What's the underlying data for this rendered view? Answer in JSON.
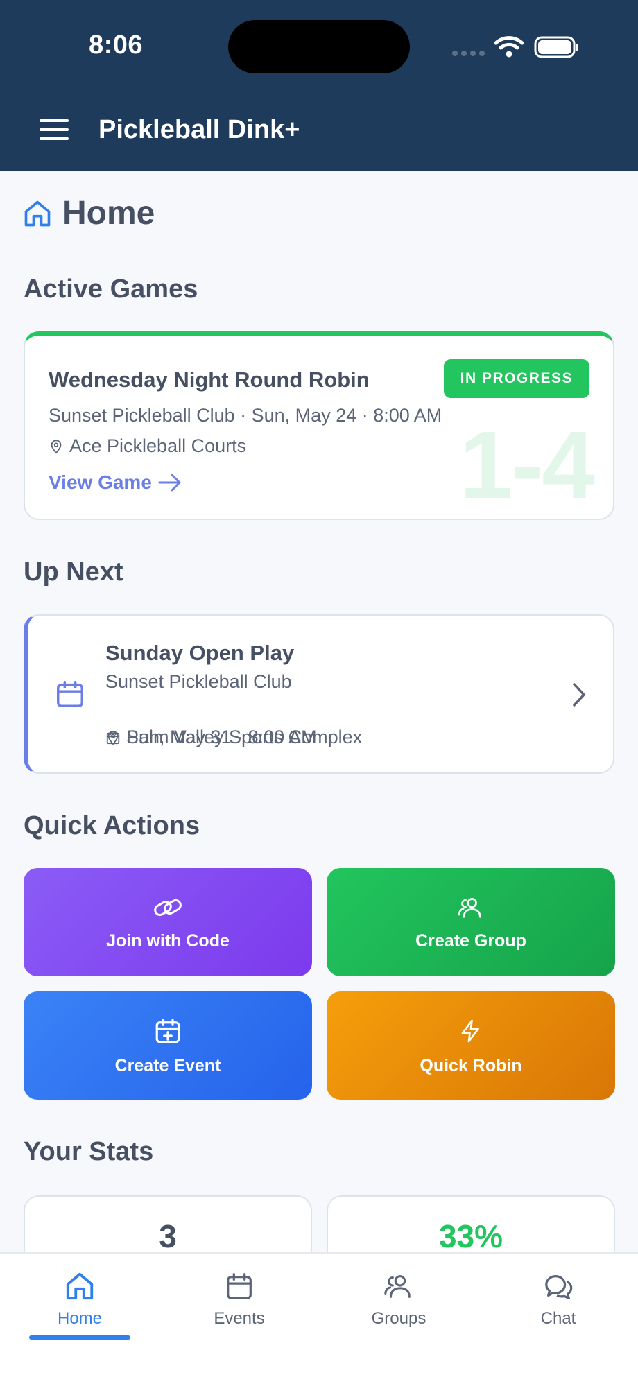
{
  "status_bar": {
    "time": "8:06"
  },
  "header": {
    "title": "Pickleball Dink+"
  },
  "page": {
    "title": "Home"
  },
  "active_games": {
    "section_title": "Active Games",
    "game": {
      "name": "Wednesday Night Round Robin",
      "status": "IN PROGRESS",
      "meta": "Sunset Pickleball Club · Sun, May 24 · 8:00 AM",
      "location": "Ace Pickleball Courts",
      "score": "1-4",
      "link_label": "View Game"
    }
  },
  "up_next": {
    "section_title": "Up Next",
    "event": {
      "name": "Sunday Open Play",
      "club": "Sunset Pickleball Club",
      "datetime": "Sun, May 31 · 8:00 AM",
      "location": "Palm Valley Sports Complex"
    }
  },
  "quick_actions": {
    "section_title": "Quick Actions",
    "items": [
      {
        "label": "Join with Code",
        "icon": "link-icon",
        "color": "#8b5cf6"
      },
      {
        "label": "Create Group",
        "icon": "users-icon",
        "color": "#22c55e"
      },
      {
        "label": "Create Event",
        "icon": "calendar-plus-icon",
        "color": "#3b82f6"
      },
      {
        "label": "Quick Robin",
        "icon": "bolt-icon",
        "color": "#f59e0b"
      }
    ]
  },
  "stats": {
    "section_title": "Your Stats",
    "items": [
      {
        "value": "3",
        "color": "#475063"
      },
      {
        "value": "33%",
        "color": "#22c55e"
      }
    ]
  },
  "tabs": [
    {
      "label": "Home",
      "icon": "home-icon",
      "active": true
    },
    {
      "label": "Events",
      "icon": "calendar-icon",
      "active": false
    },
    {
      "label": "Groups",
      "icon": "users-icon",
      "active": false
    },
    {
      "label": "Chat",
      "icon": "chat-icon",
      "active": false
    }
  ],
  "colors": {
    "header": "#1f3b5b",
    "accent": "#2f80ed",
    "success": "#22c55e",
    "link": "#6b7ee6"
  }
}
